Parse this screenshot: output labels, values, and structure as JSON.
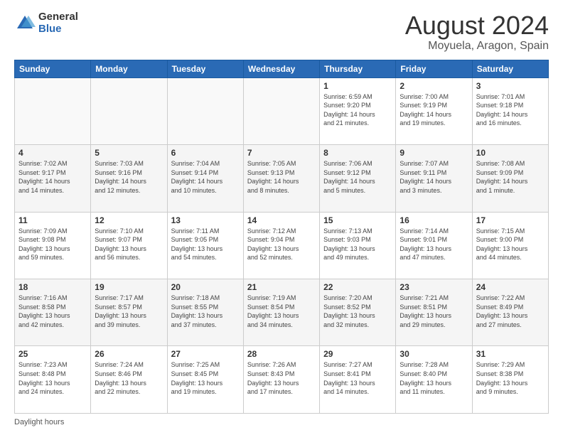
{
  "logo": {
    "general": "General",
    "blue": "Blue"
  },
  "title": "August 2024",
  "subtitle": "Moyuela, Aragon, Spain",
  "days_header": [
    "Sunday",
    "Monday",
    "Tuesday",
    "Wednesday",
    "Thursday",
    "Friday",
    "Saturday"
  ],
  "weeks": [
    [
      {
        "day": "",
        "info": ""
      },
      {
        "day": "",
        "info": ""
      },
      {
        "day": "",
        "info": ""
      },
      {
        "day": "",
        "info": ""
      },
      {
        "day": "1",
        "info": "Sunrise: 6:59 AM\nSunset: 9:20 PM\nDaylight: 14 hours\nand 21 minutes."
      },
      {
        "day": "2",
        "info": "Sunrise: 7:00 AM\nSunset: 9:19 PM\nDaylight: 14 hours\nand 19 minutes."
      },
      {
        "day": "3",
        "info": "Sunrise: 7:01 AM\nSunset: 9:18 PM\nDaylight: 14 hours\nand 16 minutes."
      }
    ],
    [
      {
        "day": "4",
        "info": "Sunrise: 7:02 AM\nSunset: 9:17 PM\nDaylight: 14 hours\nand 14 minutes."
      },
      {
        "day": "5",
        "info": "Sunrise: 7:03 AM\nSunset: 9:16 PM\nDaylight: 14 hours\nand 12 minutes."
      },
      {
        "day": "6",
        "info": "Sunrise: 7:04 AM\nSunset: 9:14 PM\nDaylight: 14 hours\nand 10 minutes."
      },
      {
        "day": "7",
        "info": "Sunrise: 7:05 AM\nSunset: 9:13 PM\nDaylight: 14 hours\nand 8 minutes."
      },
      {
        "day": "8",
        "info": "Sunrise: 7:06 AM\nSunset: 9:12 PM\nDaylight: 14 hours\nand 5 minutes."
      },
      {
        "day": "9",
        "info": "Sunrise: 7:07 AM\nSunset: 9:11 PM\nDaylight: 14 hours\nand 3 minutes."
      },
      {
        "day": "10",
        "info": "Sunrise: 7:08 AM\nSunset: 9:09 PM\nDaylight: 14 hours\nand 1 minute."
      }
    ],
    [
      {
        "day": "11",
        "info": "Sunrise: 7:09 AM\nSunset: 9:08 PM\nDaylight: 13 hours\nand 59 minutes."
      },
      {
        "day": "12",
        "info": "Sunrise: 7:10 AM\nSunset: 9:07 PM\nDaylight: 13 hours\nand 56 minutes."
      },
      {
        "day": "13",
        "info": "Sunrise: 7:11 AM\nSunset: 9:05 PM\nDaylight: 13 hours\nand 54 minutes."
      },
      {
        "day": "14",
        "info": "Sunrise: 7:12 AM\nSunset: 9:04 PM\nDaylight: 13 hours\nand 52 minutes."
      },
      {
        "day": "15",
        "info": "Sunrise: 7:13 AM\nSunset: 9:03 PM\nDaylight: 13 hours\nand 49 minutes."
      },
      {
        "day": "16",
        "info": "Sunrise: 7:14 AM\nSunset: 9:01 PM\nDaylight: 13 hours\nand 47 minutes."
      },
      {
        "day": "17",
        "info": "Sunrise: 7:15 AM\nSunset: 9:00 PM\nDaylight: 13 hours\nand 44 minutes."
      }
    ],
    [
      {
        "day": "18",
        "info": "Sunrise: 7:16 AM\nSunset: 8:58 PM\nDaylight: 13 hours\nand 42 minutes."
      },
      {
        "day": "19",
        "info": "Sunrise: 7:17 AM\nSunset: 8:57 PM\nDaylight: 13 hours\nand 39 minutes."
      },
      {
        "day": "20",
        "info": "Sunrise: 7:18 AM\nSunset: 8:55 PM\nDaylight: 13 hours\nand 37 minutes."
      },
      {
        "day": "21",
        "info": "Sunrise: 7:19 AM\nSunset: 8:54 PM\nDaylight: 13 hours\nand 34 minutes."
      },
      {
        "day": "22",
        "info": "Sunrise: 7:20 AM\nSunset: 8:52 PM\nDaylight: 13 hours\nand 32 minutes."
      },
      {
        "day": "23",
        "info": "Sunrise: 7:21 AM\nSunset: 8:51 PM\nDaylight: 13 hours\nand 29 minutes."
      },
      {
        "day": "24",
        "info": "Sunrise: 7:22 AM\nSunset: 8:49 PM\nDaylight: 13 hours\nand 27 minutes."
      }
    ],
    [
      {
        "day": "25",
        "info": "Sunrise: 7:23 AM\nSunset: 8:48 PM\nDaylight: 13 hours\nand 24 minutes."
      },
      {
        "day": "26",
        "info": "Sunrise: 7:24 AM\nSunset: 8:46 PM\nDaylight: 13 hours\nand 22 minutes."
      },
      {
        "day": "27",
        "info": "Sunrise: 7:25 AM\nSunset: 8:45 PM\nDaylight: 13 hours\nand 19 minutes."
      },
      {
        "day": "28",
        "info": "Sunrise: 7:26 AM\nSunset: 8:43 PM\nDaylight: 13 hours\nand 17 minutes."
      },
      {
        "day": "29",
        "info": "Sunrise: 7:27 AM\nSunset: 8:41 PM\nDaylight: 13 hours\nand 14 minutes."
      },
      {
        "day": "30",
        "info": "Sunrise: 7:28 AM\nSunset: 8:40 PM\nDaylight: 13 hours\nand 11 minutes."
      },
      {
        "day": "31",
        "info": "Sunrise: 7:29 AM\nSunset: 8:38 PM\nDaylight: 13 hours\nand 9 minutes."
      }
    ]
  ],
  "footer": "Daylight hours"
}
